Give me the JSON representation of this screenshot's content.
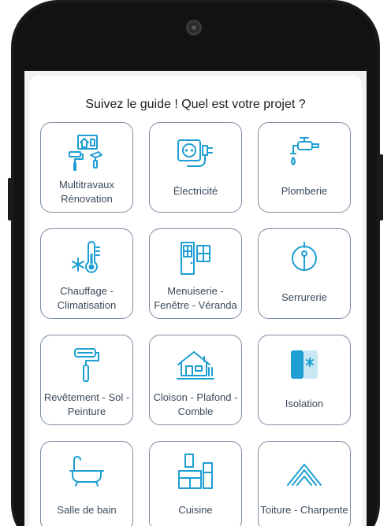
{
  "header": {
    "title": "Suivez le guide ! Quel est votre projet ?"
  },
  "categories": [
    {
      "line1": "Multitravaux",
      "line2": "Rénovation",
      "icon": "renovation-tools-icon"
    },
    {
      "line1": "Électricité",
      "line2": "",
      "icon": "electric-outlet-icon"
    },
    {
      "line1": "Plomberie",
      "line2": "",
      "icon": "faucet-icon"
    },
    {
      "line1": "Chauffage -",
      "line2": "Climatisation",
      "icon": "thermometer-snowflake-icon"
    },
    {
      "line1": "Menuiserie -",
      "line2": "Fenêtre - Véranda",
      "icon": "window-door-icon"
    },
    {
      "line1": "Serrurerie",
      "line2": "",
      "icon": "keyhole-icon"
    },
    {
      "line1": "Revêtement - Sol -",
      "line2": "Peinture",
      "icon": "paint-roller-icon"
    },
    {
      "line1": "Cloison - Plafond -",
      "line2": "Comble",
      "icon": "house-interior-icon"
    },
    {
      "line1": "Isolation",
      "line2": "",
      "icon": "insulation-panel-icon"
    },
    {
      "line1": "Salle de bain",
      "line2": "",
      "icon": "bathtub-icon"
    },
    {
      "line1": "Cuisine",
      "line2": "",
      "icon": "kitchen-icon"
    },
    {
      "line1": "Toiture - Charpente",
      "line2": "",
      "icon": "roof-icon"
    }
  ]
}
